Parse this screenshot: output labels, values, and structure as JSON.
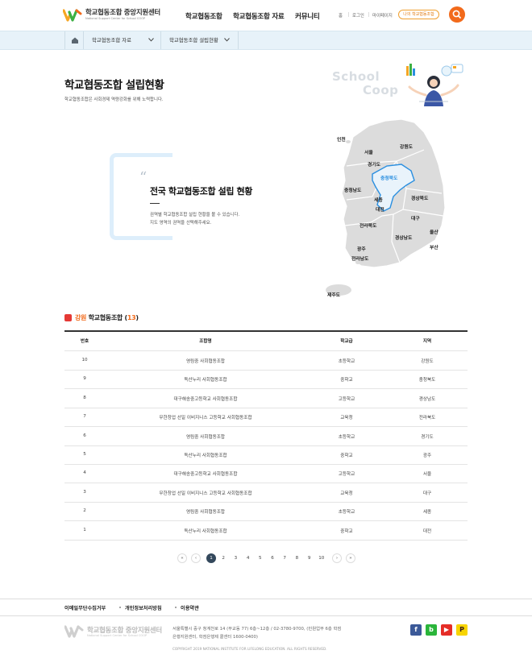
{
  "header": {
    "logo_kr": "학교협동조합 중앙지원센터",
    "logo_en": "National Support Center for School COOP",
    "nav": [
      "학교협동조합",
      "학교협동조합 자료",
      "커뮤니티"
    ],
    "util": [
      "홈",
      "로그인",
      "마이페이지"
    ],
    "my_button": "나의 학교협동조합"
  },
  "breadcrumb": {
    "items": [
      "학교협동조합 자료",
      "학교협동조합 설립현황"
    ]
  },
  "page": {
    "title": "학교협동조합 설립현황",
    "subtitle": "학교협동조합은 사회경제 역량강화를 위해 노력합니다.",
    "bg_word_1": "School",
    "bg_word_2": "Coop"
  },
  "intro": {
    "quote_mark": "“",
    "title": "전국 학교협동조합 설립 현황",
    "desc_1": "권역별 학교협동조합 설립 현황을 볼 수 있습니다.",
    "desc_2": "지도 영역의 권역을 선택해주세요."
  },
  "map": {
    "regions": [
      "인천",
      "서울",
      "강원도",
      "경기도",
      "충청북도",
      "충청남도",
      "세종",
      "대전",
      "경상북도",
      "대구",
      "전라북도",
      "울산",
      "경상남도",
      "부산",
      "광주",
      "전라남도",
      "제주도"
    ],
    "active": "충청북도"
  },
  "section": {
    "region": "강원",
    "label": "학교협동조합",
    "count": "13",
    "open_paren": "(",
    "close_paren": ")"
  },
  "table": {
    "headers": [
      "번호",
      "조합명",
      "학교급",
      "지역"
    ],
    "rows": [
      [
        "10",
        "영림중 사회협동조합",
        "초등학교",
        "강원도"
      ],
      [
        "9",
        "독산누리 사회협동조합",
        "중학교",
        "충청북도"
      ],
      [
        "8",
        "대구해송중고등학교 사회협동조합",
        "고등학교",
        "경상남도"
      ],
      [
        "7",
        "무한창업 선일 이비지니스 고등학교 사회협동조합",
        "교육청",
        "전라북도"
      ],
      [
        "6",
        "영림중 사회협동조합",
        "초등학교",
        "경기도"
      ],
      [
        "5",
        "독산누리 사회협동조합",
        "중학교",
        "광주"
      ],
      [
        "4",
        "대구해송중고등학교 사회협동조합",
        "고등학교",
        "서울"
      ],
      [
        "3",
        "무한창업 선일 이비지니스 고등학교 사회협동조합",
        "교육청",
        "대구"
      ],
      [
        "2",
        "영림중 사회협동조합",
        "초등학교",
        "세종"
      ],
      [
        "1",
        "독산누리 사회협동조합",
        "중학교",
        "대전"
      ]
    ]
  },
  "pagination": {
    "first": "«",
    "prev": "‹",
    "pages": [
      "1",
      "2",
      "3",
      "4",
      "5",
      "6",
      "7",
      "8",
      "9",
      "10"
    ],
    "current": "1",
    "next": "›",
    "last": "»"
  },
  "footer": {
    "links": [
      "이메일무단수집거부",
      "개인정보처리방침",
      "이용약관"
    ],
    "logo_kr": "학교협동조합 중앙지원센터",
    "logo_en": "National Support Center for School COOP",
    "address_1": "서울특별시 중구 청계천로 14 (무교동 77) 6층~12층 / 02-3780-9700, (민원업무 6층 학점",
    "address_2": "은행지원센터, 학점은행제 콜센터 1600-0400)",
    "copyright": "COPYRIGHT 2019 NATIONAL INSTITUTE FOR LIFELONG EDUCATION. ALL RIGHTS RESERVED.",
    "sns": [
      {
        "name": "facebook",
        "glyph": "f",
        "color": "#3b5998"
      },
      {
        "name": "band",
        "glyph": "b",
        "color": "#2ab53a"
      },
      {
        "name": "youtube",
        "glyph": "▶",
        "color": "#e52d27"
      },
      {
        "name": "kakao",
        "glyph": "P",
        "color": "#f7d400"
      }
    ]
  },
  "colors": {
    "accent": "#f26a1b",
    "map_active": "#2a8fe0",
    "breadcrumb_bg": "#e7f2f9",
    "page_active": "#33485c"
  }
}
